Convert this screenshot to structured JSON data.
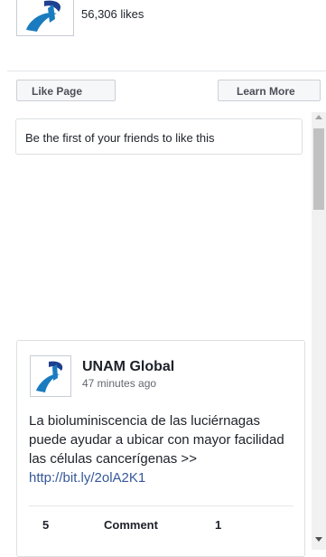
{
  "page": {
    "likes_text": "56,306 likes",
    "logo_icon": "unam-global-logo-icon"
  },
  "buttons": {
    "like_page": "Like Page",
    "learn_more": "Learn More"
  },
  "friends": {
    "text": "Be the first of your friends to like this"
  },
  "post": {
    "author": "UNAM Global",
    "time": "47 minutes ago",
    "body": "La bioluminiscencia de las luciérnagas puede ayudar a ubicar con mayor facilidad las células cancerígenas >> ",
    "link": "http://bit.ly/2olA2K1",
    "actions": {
      "likes": "5",
      "comment": "Comment",
      "shares": "1"
    }
  },
  "colors": {
    "link": "#365899",
    "logo_blue": "#1a7bbf",
    "logo_navy": "#1f3f8f"
  }
}
